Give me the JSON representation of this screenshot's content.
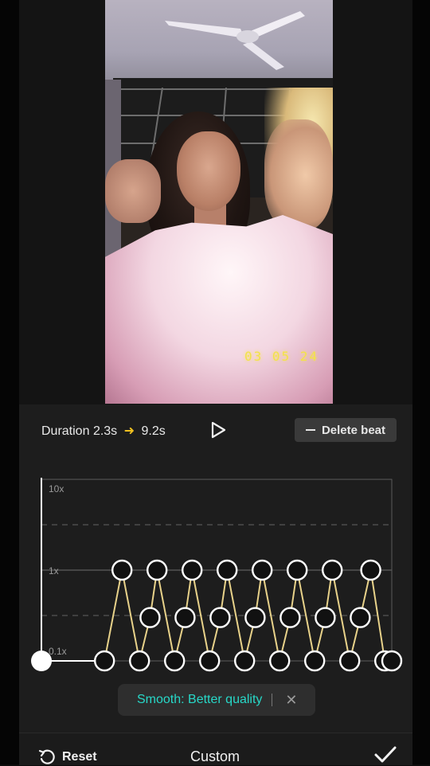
{
  "preview": {
    "date_stamp": "03 05 24"
  },
  "toolbar": {
    "duration_label": "Duration",
    "duration_from": "2.3s",
    "duration_arrow": "➜",
    "duration_to": "9.2s",
    "delete_beat_label": "Delete beat"
  },
  "curve": {
    "labels": [
      "10x",
      "1x",
      "0.1x"
    ],
    "speed_points": [
      {
        "t": 0.0,
        "speed": 0.1
      },
      {
        "t": 0.18,
        "speed": 0.1
      },
      {
        "t": 0.23,
        "speed": 1
      },
      {
        "t": 0.28,
        "speed": 0.1
      },
      {
        "t": 0.31,
        "speed": 0.3
      },
      {
        "t": 0.33,
        "speed": 1
      },
      {
        "t": 0.38,
        "speed": 0.1
      },
      {
        "t": 0.41,
        "speed": 0.3
      },
      {
        "t": 0.43,
        "speed": 1
      },
      {
        "t": 0.48,
        "speed": 0.1
      },
      {
        "t": 0.51,
        "speed": 0.3
      },
      {
        "t": 0.53,
        "speed": 1
      },
      {
        "t": 0.58,
        "speed": 0.1
      },
      {
        "t": 0.61,
        "speed": 0.3
      },
      {
        "t": 0.63,
        "speed": 1
      },
      {
        "t": 0.68,
        "speed": 0.1
      },
      {
        "t": 0.71,
        "speed": 0.3
      },
      {
        "t": 0.73,
        "speed": 1
      },
      {
        "t": 0.78,
        "speed": 0.1
      },
      {
        "t": 0.81,
        "speed": 0.3
      },
      {
        "t": 0.83,
        "speed": 1
      },
      {
        "t": 0.88,
        "speed": 0.1
      },
      {
        "t": 0.91,
        "speed": 0.3
      },
      {
        "t": 0.94,
        "speed": 1
      },
      {
        "t": 0.98,
        "speed": 0.1
      },
      {
        "t": 1.0,
        "speed": 0.1
      }
    ],
    "playhead": 0.0,
    "accent_color": "#e8d28a"
  },
  "toast": {
    "text": "Smooth: Better quality",
    "close_glyph": "✕"
  },
  "bottom_bar": {
    "reset_label": "Reset",
    "title": "Custom"
  }
}
